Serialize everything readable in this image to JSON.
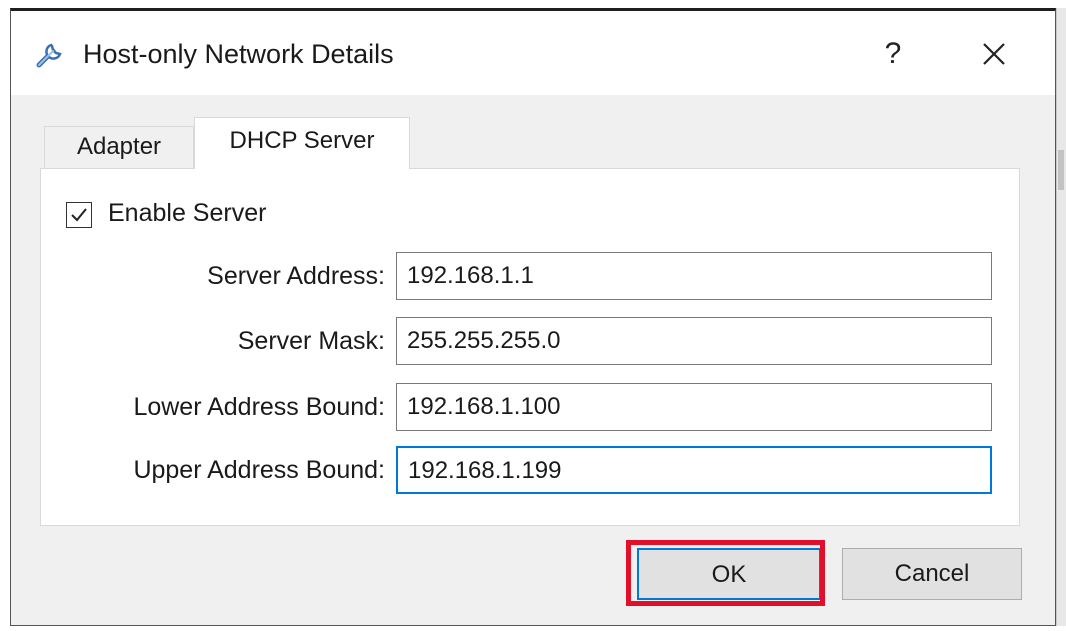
{
  "window": {
    "title": "Host-only Network Details",
    "help_label": "?",
    "icon": "wrench-icon"
  },
  "tabs": [
    {
      "label": "Adapter",
      "active": false
    },
    {
      "label": "DHCP Server",
      "active": true
    }
  ],
  "dhcp": {
    "enable_label": "Enable Server",
    "enable_checked": true,
    "fields": [
      {
        "label": "Server Address:",
        "value": "192.168.1.1"
      },
      {
        "label": "Server Mask:",
        "value": "255.255.255.0"
      },
      {
        "label": "Lower Address Bound:",
        "value": "192.168.1.100"
      },
      {
        "label": "Upper Address Bound:",
        "value": "192.168.1.199"
      }
    ]
  },
  "buttons": {
    "ok_label": "OK",
    "cancel_label": "Cancel"
  },
  "colors": {
    "highlight": "#e0102a",
    "focus": "#0078d7"
  }
}
